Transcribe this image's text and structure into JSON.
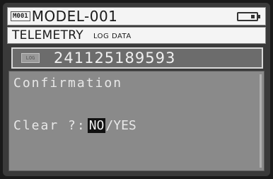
{
  "header": {
    "model_tag": "M001",
    "model_name": "MODEL-001",
    "battery_icon": "battery-icon"
  },
  "title": {
    "main": "TELEMETRY",
    "sub": "LOG DATA"
  },
  "log": {
    "icon_label": "LOG",
    "id": "241125189593"
  },
  "dialog": {
    "title": "Confirmation",
    "prompt": "Clear ?:",
    "option_no": "NO",
    "separator": "/",
    "option_yes": "YES",
    "selected": "NO"
  },
  "colors": {
    "background": "#3a3a3a",
    "bar_bg": "#f4f4f4",
    "log_bar_bg": "#6c6c6c",
    "panel_bg": "#8a8a8a",
    "highlight": "#111111"
  }
}
